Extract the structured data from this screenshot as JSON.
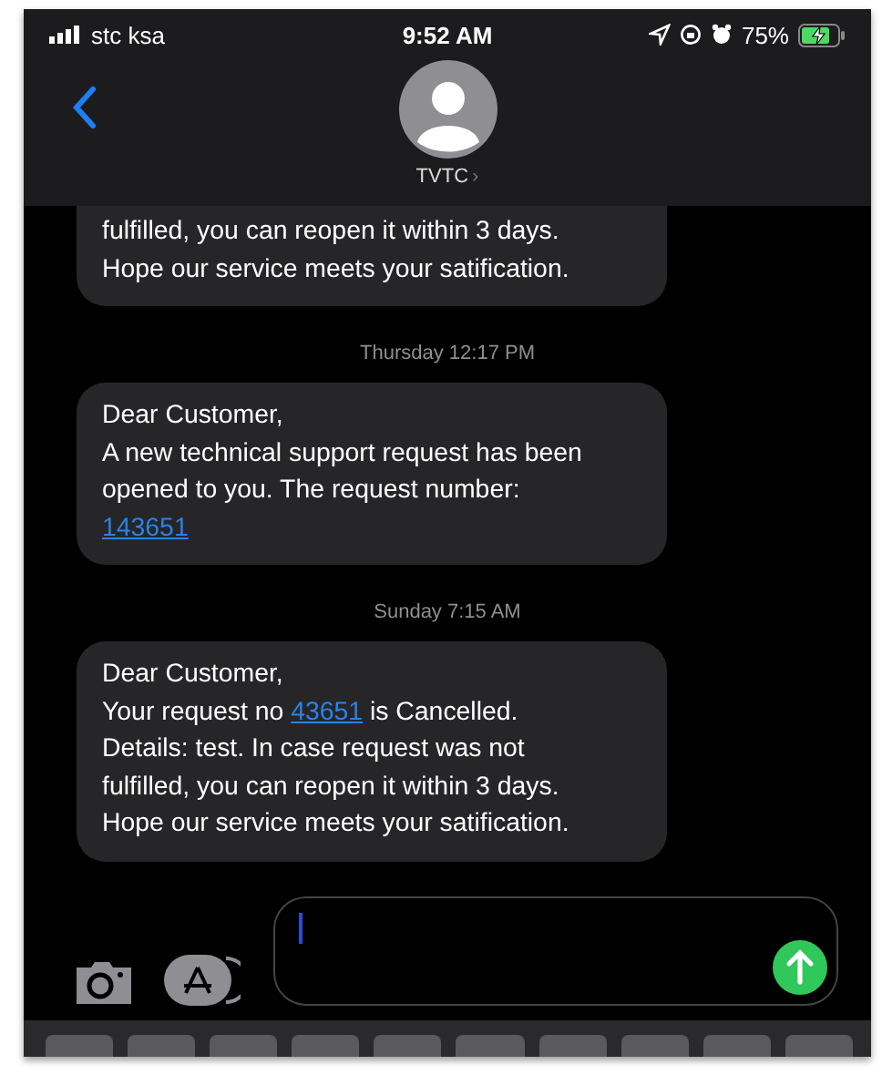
{
  "status_bar": {
    "carrier": "stc ksa",
    "time": "9:52 AM",
    "battery": "75%",
    "charging": true
  },
  "header": {
    "contact": "TVTC",
    "chevron": "›"
  },
  "thread": [
    {
      "kind": "message",
      "cut_top": true,
      "lines": [
        [
          {
            "kind": "text",
            "text": "fulfilled, you can reopen it within 3 days."
          }
        ],
        [
          {
            "kind": "text",
            "text": "Hope our service meets your satification."
          }
        ]
      ]
    },
    {
      "kind": "timestamp",
      "text": "Thursday 12:17 PM"
    },
    {
      "kind": "message",
      "cut_top": false,
      "lines": [
        [
          {
            "kind": "text",
            "text": "Dear Customer,"
          }
        ],
        [
          {
            "kind": "text",
            "text": "A new technical support request has been"
          }
        ],
        [
          {
            "kind": "text",
            "text": "opened to you. The request number:"
          }
        ],
        [
          {
            "kind": "link",
            "text": "143651"
          }
        ]
      ]
    },
    {
      "kind": "timestamp",
      "text": "Sunday 7:15 AM"
    },
    {
      "kind": "message",
      "cut_top": false,
      "lines": [
        [
          {
            "kind": "text",
            "text": "Dear Customer,"
          }
        ],
        [
          {
            "kind": "text",
            "text": "Your request no "
          },
          {
            "kind": "link",
            "text": "43651"
          },
          {
            "kind": "text",
            "text": " is Cancelled."
          }
        ],
        [
          {
            "kind": "text",
            "text": "Details: test. In case request was not"
          }
        ],
        [
          {
            "kind": "text",
            "text": "fulfilled, you can reopen it within 3 days."
          }
        ],
        [
          {
            "kind": "text",
            "text": "Hope our service meets your satification."
          }
        ]
      ]
    }
  ]
}
